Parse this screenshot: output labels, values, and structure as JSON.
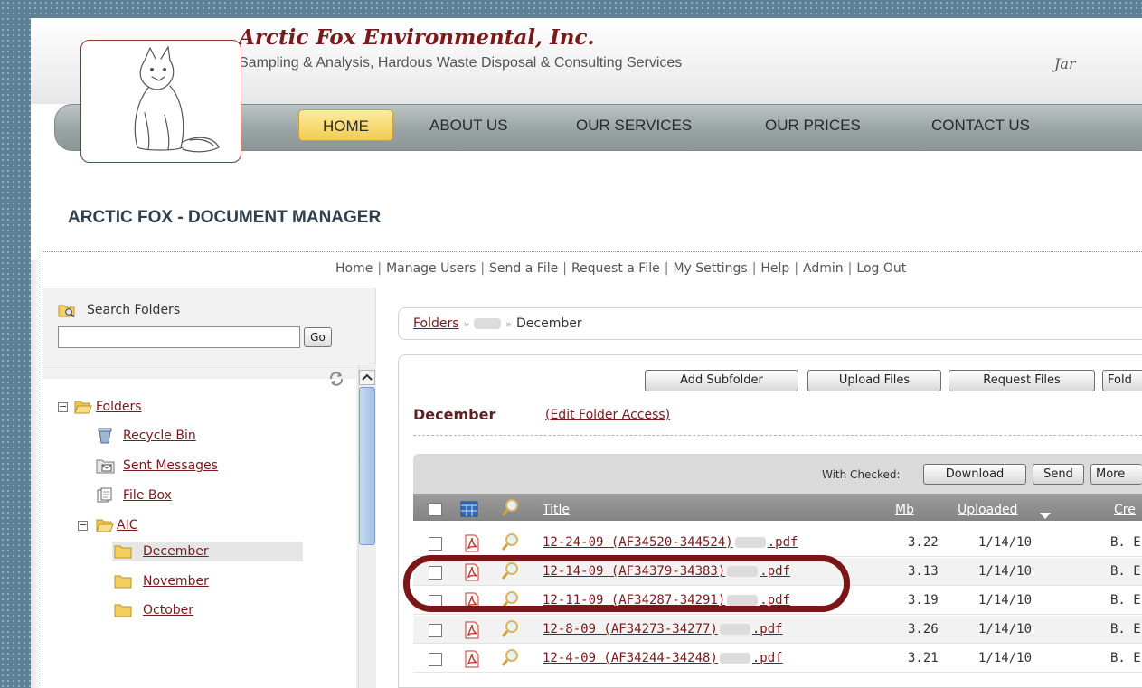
{
  "site": {
    "company": "Arctic Fox Environmental, Inc.",
    "tagline": "Sampling & Analysis, Hardous Waste Disposal & Consulting Services",
    "date_partial": "Jar"
  },
  "nav": {
    "items": [
      {
        "label": "HOME",
        "active": true
      },
      {
        "label": "ABOUT US"
      },
      {
        "label": "OUR SERVICES"
      },
      {
        "label": "OUR PRICES"
      },
      {
        "label": "CONTACT US"
      }
    ]
  },
  "page_title": "ARCTIC FOX - DOCUMENT MANAGER",
  "toplinks": [
    "Home",
    "Manage Users",
    "Send a File",
    "Request a File",
    "My Settings",
    "Help",
    "Admin",
    "Log Out"
  ],
  "search": {
    "label": "Search Folders",
    "value": "",
    "go_label": "Go"
  },
  "tree": {
    "root": "Folders",
    "items": [
      {
        "label": "Recycle Bin",
        "icon": "recycle-bin-icon"
      },
      {
        "label": "Sent Messages",
        "icon": "sent-messages-icon"
      },
      {
        "label": "File Box",
        "icon": "file-box-icon"
      },
      {
        "label": "AIC",
        "icon": "folder-open-icon"
      },
      {
        "label": "December",
        "icon": "folder-icon",
        "selected": true
      },
      {
        "label": "November",
        "icon": "folder-icon"
      },
      {
        "label": "October",
        "icon": "folder-icon"
      }
    ]
  },
  "breadcrumb": {
    "root": "Folders",
    "current": "December"
  },
  "folder_actions": {
    "add_subfolder": "Add Subfolder",
    "upload_files": "Upload Files",
    "request_files": "Request Files",
    "folder_partial": "Fold"
  },
  "folder": {
    "name": "December",
    "edit_access": "(Edit Folder Access)"
  },
  "with_checked": {
    "label": "With Checked:",
    "download": "Download",
    "send": "Send",
    "more_partial": "More"
  },
  "table": {
    "headers": {
      "title": "Title",
      "mb": "Mb",
      "uploaded": "Uploaded",
      "created_partial": "Cre"
    },
    "rows": [
      {
        "title_prefix": "12-24-09 (AF34520-344524)",
        "title_suffix": ".pdf",
        "mb": "3.22",
        "uploaded": "1/14/10",
        "created_by": "B. E"
      },
      {
        "title_prefix": "12-14-09 (AF34379-34383)",
        "title_suffix": ".pdf",
        "mb": "3.13",
        "uploaded": "1/14/10",
        "created_by": "B. E"
      },
      {
        "title_prefix": "12-11-09 (AF34287-34291)",
        "title_suffix": ".pdf",
        "mb": "3.19",
        "uploaded": "1/14/10",
        "created_by": "B. E"
      },
      {
        "title_prefix": "12-8-09 (AF34273-34277)",
        "title_suffix": ".pdf",
        "mb": "3.26",
        "uploaded": "1/14/10",
        "created_by": "B. E"
      },
      {
        "title_prefix": "12-4-09 (AF34244-34248)",
        "title_suffix": ".pdf",
        "mb": "3.21",
        "uploaded": "1/14/10",
        "created_by": "B. E"
      }
    ]
  },
  "colors": {
    "brand": "#7a1a1a",
    "highlight_ring": "#7a1616",
    "nav_active": "#f4d35e",
    "table_header": "#8e8e8e"
  }
}
